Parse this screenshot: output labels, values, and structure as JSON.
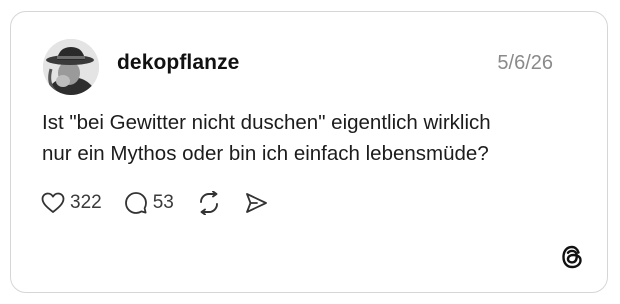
{
  "post": {
    "username": "dekopflanze",
    "date": "5/6/26",
    "text_lines": [
      "Ist \"bei Gewitter nicht duschen\" eigentlich wirklich",
      "nur ein Mythos oder bin ich einfach lebensmüde?"
    ],
    "avatar_icon": "profile-photo"
  },
  "actions": {
    "likes": {
      "icon": "heart-icon",
      "count": "322"
    },
    "replies": {
      "icon": "comment-icon",
      "count": "53"
    },
    "repost": {
      "icon": "repost-icon"
    },
    "share": {
      "icon": "share-icon"
    }
  },
  "brand": {
    "icon": "threads-logo-icon"
  },
  "colors": {
    "border": "#d6d6d6",
    "date_text": "#8a8a8a",
    "text": "#1c1c1c"
  }
}
